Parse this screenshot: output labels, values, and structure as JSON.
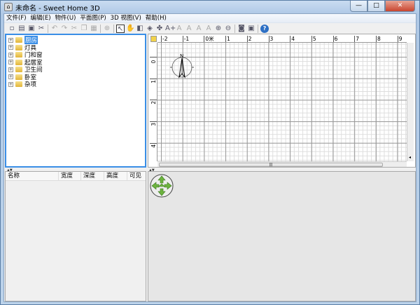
{
  "window": {
    "title": "未命名 - Sweet Home 3D",
    "minimize": "—",
    "maximize": "□",
    "close": "✕"
  },
  "menu": [
    "文件(F)",
    "编辑(E)",
    "物件(U)",
    "平面图(P)",
    "3D 视图(V)",
    "帮助(H)"
  ],
  "toolbar": [
    {
      "icon": "new-icon",
      "glyph": "▫"
    },
    {
      "icon": "open-icon",
      "glyph": "▤"
    },
    {
      "icon": "save-icon",
      "glyph": "▣"
    },
    {
      "icon": "cut-scissors-icon",
      "glyph": "✂"
    },
    {
      "sep": true
    },
    {
      "icon": "undo-icon",
      "glyph": "↶",
      "disabled": true
    },
    {
      "icon": "redo-icon",
      "glyph": "↷",
      "disabled": true
    },
    {
      "icon": "cut-icon",
      "glyph": "✂",
      "disabled": true
    },
    {
      "icon": "copy-icon",
      "glyph": "❐",
      "disabled": true
    },
    {
      "icon": "paste-icon",
      "glyph": "▦",
      "disabled": true
    },
    {
      "sep": true
    },
    {
      "icon": "add-furniture-icon",
      "glyph": "⊕",
      "disabled": true
    },
    {
      "sep": true
    },
    {
      "icon": "select-icon",
      "glyph": "↖",
      "selected": true
    },
    {
      "icon": "pan-icon",
      "glyph": "✋"
    },
    {
      "icon": "create-walls-icon",
      "glyph": "◧"
    },
    {
      "icon": "create-rooms-icon",
      "glyph": "◈"
    },
    {
      "icon": "create-dimensions-icon",
      "glyph": "✤"
    },
    {
      "icon": "add-text-icon",
      "glyph": "A+"
    },
    {
      "icon": "text-style-icon",
      "glyph": "A",
      "disabled": true
    },
    {
      "icon": "bold-icon",
      "glyph": "A",
      "disabled": true
    },
    {
      "icon": "italic-icon",
      "glyph": "A",
      "disabled": true
    },
    {
      "icon": "text-size-icon",
      "glyph": "A",
      "disabled": true
    },
    {
      "icon": "zoom-in-icon",
      "glyph": "⊕"
    },
    {
      "icon": "zoom-out-icon",
      "glyph": "⊖"
    },
    {
      "sep": true
    },
    {
      "icon": "photo-icon",
      "glyph": "◙"
    },
    {
      "icon": "video-icon",
      "glyph": "▣"
    },
    {
      "sep": true
    },
    {
      "icon": "help-icon",
      "glyph": "?"
    }
  ],
  "catalog": {
    "items": [
      "厨房",
      "灯具",
      "门和窗",
      "起居室",
      "卫生间",
      "卧室",
      "杂项"
    ],
    "selected": 0
  },
  "furniture_table": {
    "columns": [
      "名称",
      "宽度",
      "深度",
      "高度",
      "可见"
    ]
  },
  "plan": {
    "x_ruler": [
      "-2",
      "-1",
      "0米",
      "1",
      "2",
      "3",
      "4",
      "5",
      "6",
      "7",
      "8",
      "9"
    ],
    "y_ruler": [
      "0米",
      "1",
      "2",
      "3",
      "4"
    ],
    "compass_label": "N",
    "scroll_grip": "|||"
  },
  "colors": {
    "selection": "#3a8ee6",
    "folder": "#e2b53a",
    "nav_arrows": "#6db33f"
  }
}
